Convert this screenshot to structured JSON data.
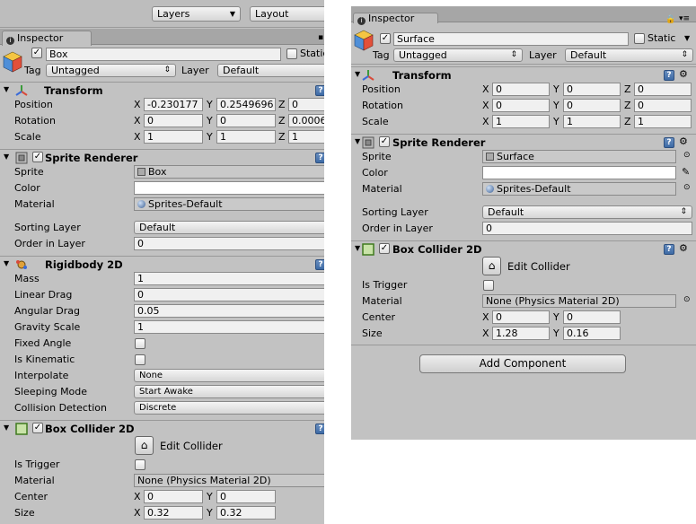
{
  "left": {
    "topbar": {
      "layers": "Layers",
      "layout": "Layout"
    },
    "tab": "Inspector",
    "object_name": "Box",
    "static_label": "Static",
    "tag_label": "Tag",
    "tag_value": "Untagged",
    "layer_label": "Layer",
    "layer_value": "Default",
    "transform": {
      "title": "Transform",
      "position": {
        "label": "Position",
        "x": "-0.230177",
        "y": "0.2549696",
        "z": "0"
      },
      "rotation": {
        "label": "Rotation",
        "x": "0",
        "y": "0",
        "z": "0.0006"
      },
      "scale": {
        "label": "Scale",
        "x": "1",
        "y": "1",
        "z": "1"
      }
    },
    "sprite_renderer": {
      "title": "Sprite Renderer",
      "sprite_label": "Sprite",
      "sprite_value": "Box",
      "color_label": "Color",
      "material_label": "Material",
      "material_value": "Sprites-Default",
      "sorting_label": "Sorting Layer",
      "sorting_value": "Default",
      "order_label": "Order in Layer",
      "order_value": "0"
    },
    "rigidbody": {
      "title": "Rigidbody 2D",
      "mass_label": "Mass",
      "mass": "1",
      "linear_label": "Linear Drag",
      "linear": "0",
      "angular_label": "Angular Drag",
      "angular": "0.05",
      "gravity_label": "Gravity Scale",
      "gravity": "1",
      "fixed_label": "Fixed Angle",
      "kinematic_label": "Is Kinematic",
      "interp_label": "Interpolate",
      "interp": "None",
      "sleep_label": "Sleeping Mode",
      "sleep": "Start Awake",
      "coll_label": "Collision Detection",
      "coll": "Discrete"
    },
    "box_collider": {
      "title": "Box Collider 2D",
      "edit": "Edit Collider",
      "trigger_label": "Is Trigger",
      "material_label": "Material",
      "material_value": "None (Physics Material 2D)",
      "center_label": "Center",
      "center_x": "0",
      "center_y": "0",
      "size_label": "Size",
      "size_x": "0.32",
      "size_y": "0.32"
    }
  },
  "right": {
    "tab": "Inspector",
    "object_name": "Surface",
    "static_label": "Static",
    "tag_label": "Tag",
    "tag_value": "Untagged",
    "layer_label": "Layer",
    "layer_value": "Default",
    "transform": {
      "title": "Transform",
      "position": {
        "label": "Position",
        "x": "0",
        "y": "0",
        "z": "0"
      },
      "rotation": {
        "label": "Rotation",
        "x": "0",
        "y": "0",
        "z": "0"
      },
      "scale": {
        "label": "Scale",
        "x": "1",
        "y": "1",
        "z": "1"
      }
    },
    "sprite_renderer": {
      "title": "Sprite Renderer",
      "sprite_label": "Sprite",
      "sprite_value": "Surface",
      "color_label": "Color",
      "material_label": "Material",
      "material_value": "Sprites-Default",
      "sorting_label": "Sorting Layer",
      "sorting_value": "Default",
      "order_label": "Order in Layer",
      "order_value": "0"
    },
    "box_collider": {
      "title": "Box Collider 2D",
      "edit": "Edit Collider",
      "trigger_label": "Is Trigger",
      "material_label": "Material",
      "material_value": "None (Physics Material 2D)",
      "center_label": "Center",
      "center_x": "0",
      "center_y": "0",
      "size_label": "Size",
      "size_x": "1.28",
      "size_y": "0.16"
    },
    "add_component": "Add Component"
  },
  "axes": {
    "x": "X",
    "y": "Y",
    "z": "Z"
  },
  "colors": {
    "panel_bg": "#c2c2c2",
    "field_bg": "#f0f0f0",
    "help_icon": "#4a76b0"
  }
}
